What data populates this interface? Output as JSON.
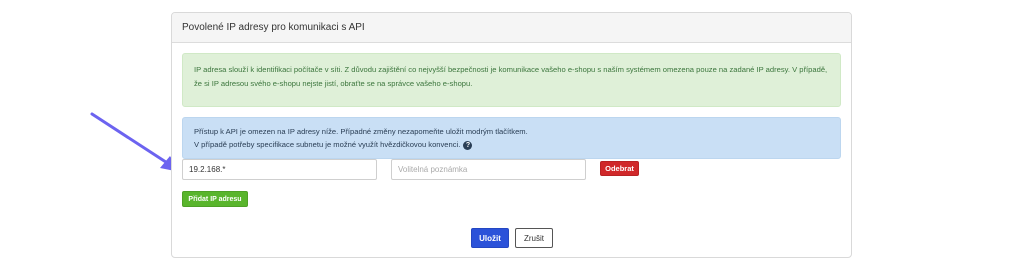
{
  "panel": {
    "title": "Povolené IP adresy pro komunikaci s API"
  },
  "alerts": {
    "success_text": "IP adresa slouží k identifikaci počítače v síti. Z důvodu zajištění co nejvyšší bezpečnosti je komunikace vašeho e-shopu s naším systémem omezena pouze na zadané IP adresy. V případě, že si IP adresou svého e-shopu nejste jistí, obraťte se na správce vašeho e-shopu.",
    "info_line1": "Přístup k API je omezen na IP adresy níže. Případné změny nezapomeňte uložit modrým tlačítkem.",
    "info_line2": "V případě potřeby specifikace subnetu je možné využít hvězdičkovou konvenci.",
    "help_icon": "?"
  },
  "form": {
    "ip_value": "19.2.168.*",
    "note_placeholder": "Volitelná poznámka",
    "remove_label": "Odebrat",
    "add_label": "Přidat IP adresu",
    "save_label": "Uložit",
    "cancel_label": "Zrušit"
  },
  "colors": {
    "arrow": "#6c63f0",
    "save": "#2b52d9",
    "remove": "#d0282a",
    "add": "#59b52c"
  }
}
